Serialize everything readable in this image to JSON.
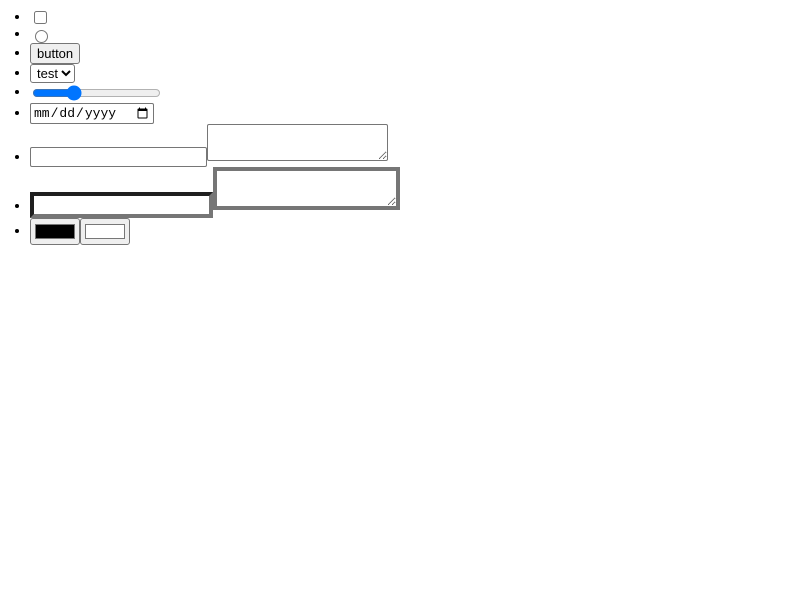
{
  "controls": {
    "checkbox": {
      "checked": false
    },
    "radio": {
      "checked": false
    },
    "button": {
      "label": "button"
    },
    "select": {
      "selected": "test",
      "options": [
        "test"
      ]
    },
    "range": {
      "value": 30,
      "min": 0,
      "max": 100
    },
    "date": {
      "placeholder": "mm/dd/yyyy"
    },
    "text_input": {
      "value": ""
    },
    "textarea": {
      "value": ""
    },
    "thick_text_input": {
      "value": ""
    },
    "thick_textarea": {
      "value": ""
    },
    "color_black": {
      "value": "#000000"
    },
    "color_white": {
      "value": "#ffffff"
    }
  },
  "colors": {
    "accent": "#0075ff",
    "border": "#767676",
    "border_dark": "#1f1f1f",
    "button_bg": "#efefef"
  }
}
